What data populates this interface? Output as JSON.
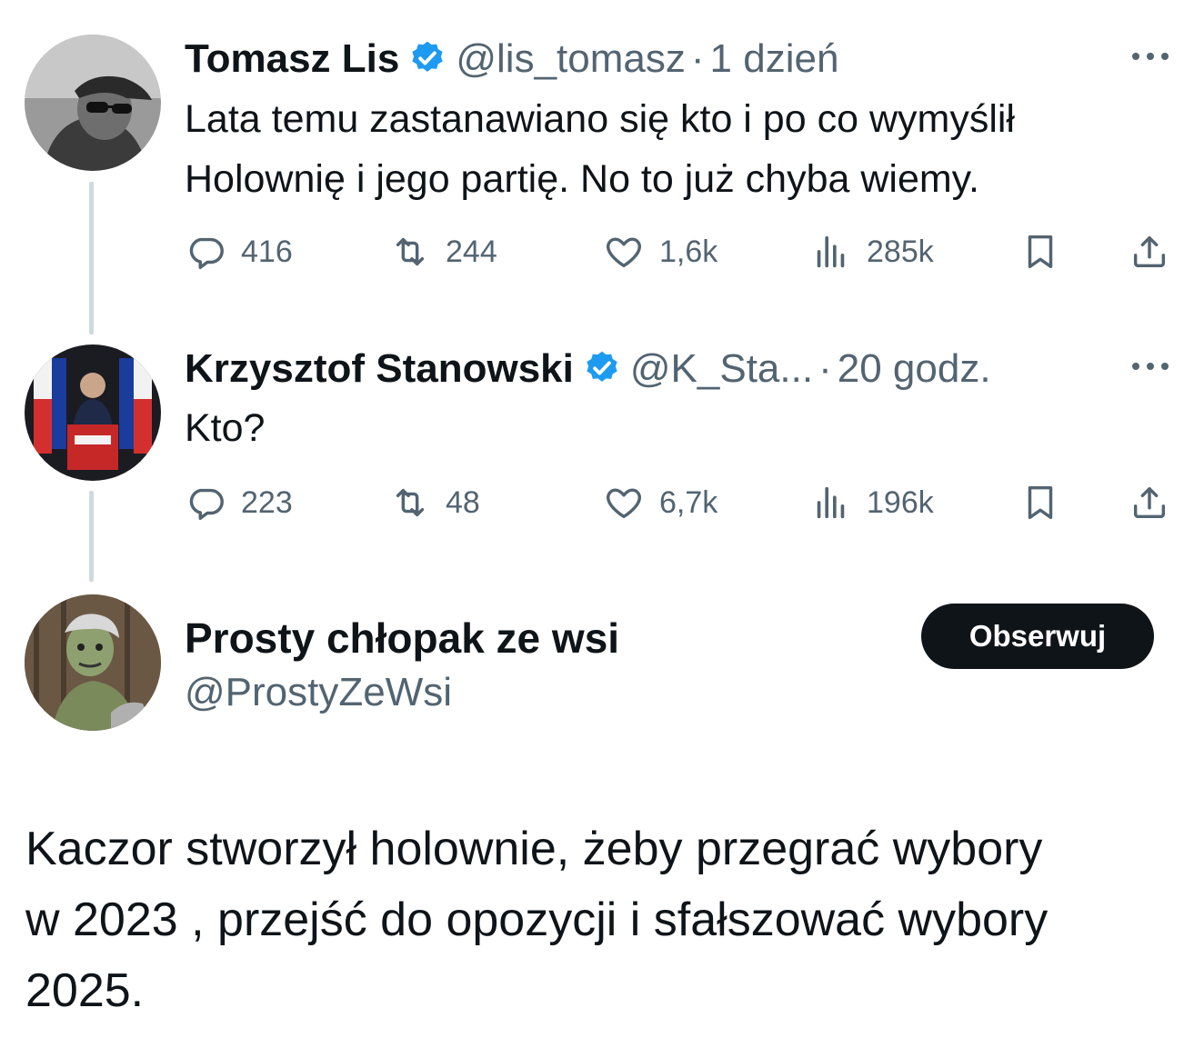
{
  "tweets": [
    {
      "name": "Tomasz Lis",
      "handle": "@lis_tomasz",
      "separator": "·",
      "time": "1 dzień",
      "text_lines": [
        "Lata temu zastanawiano się kto i po co wymyślił",
        "Holownię i jego partię. No to już chyba wiemy."
      ],
      "replies": "416",
      "retweets": "244",
      "likes": "1,6k",
      "views": "285k",
      "verified": true
    },
    {
      "name": "Krzysztof Stanowski",
      "handle": "@K_Sta...",
      "separator": "·",
      "time": "20 godz.",
      "text_lines": [
        "Kto?"
      ],
      "replies": "223",
      "retweets": "48",
      "likes": "6,7k",
      "views": "196k",
      "verified": true
    }
  ],
  "post": {
    "name": "Prosty chłopak ze wsi",
    "handle": "@ProstyZeWsi",
    "follow_label": "Obserwuj",
    "text": "Kaczor stworzył holownie, żeby przegrać wybory\nw 2023 , przejść do opozycji i sfałszować wybory\n2025."
  },
  "icons": {
    "verified": "verified-badge-icon",
    "reply": "reply-icon",
    "retweet": "retweet-icon",
    "like": "heart-icon",
    "views": "views-icon",
    "bookmark": "bookmark-icon",
    "share": "share-icon",
    "more": "more-icon"
  },
  "colors": {
    "verified_blue": "#1d9bf0",
    "text": "#0f1419",
    "secondary": "#536471",
    "follow_bg": "#0f1419"
  }
}
